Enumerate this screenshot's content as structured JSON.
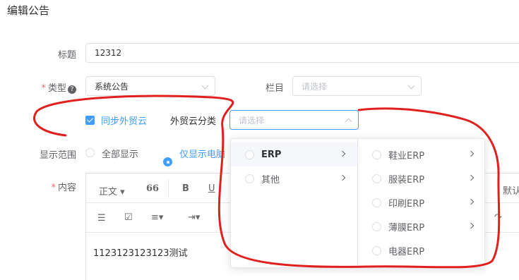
{
  "page": {
    "title": "编辑公告"
  },
  "form": {
    "title_label": "标题",
    "title_value": "12312",
    "type_label": "类型",
    "type_value": "系统公告",
    "column_label": "栏目",
    "column_placeholder": "请选择",
    "sync_label": "同步外贸云",
    "sync_checked": true,
    "category_label": "外贸云分类",
    "category_placeholder": "请选择",
    "display_label": "显示范围",
    "display_options": [
      "全部显示",
      "仅显示电脑"
    ],
    "display_selected": 1,
    "content_label": "内容"
  },
  "editor": {
    "toolbar_row1": [
      "正文",
      "66",
      "B",
      "U",
      "默认"
    ],
    "content": "1123123123123测试"
  },
  "cascader": {
    "level1": [
      {
        "label": "ERP",
        "has_children": true,
        "active": true
      },
      {
        "label": "其他",
        "has_children": true,
        "active": false
      }
    ],
    "level2": [
      {
        "label": "鞋业ERP",
        "has_children": true
      },
      {
        "label": "服装ERP",
        "has_children": true
      },
      {
        "label": "印刷ERP",
        "has_children": true
      },
      {
        "label": "薄膜ERP",
        "has_children": true
      },
      {
        "label": "电器ERP",
        "has_children": false
      }
    ]
  },
  "annotation_color": "#e0201c",
  "accent_color": "#409eff"
}
